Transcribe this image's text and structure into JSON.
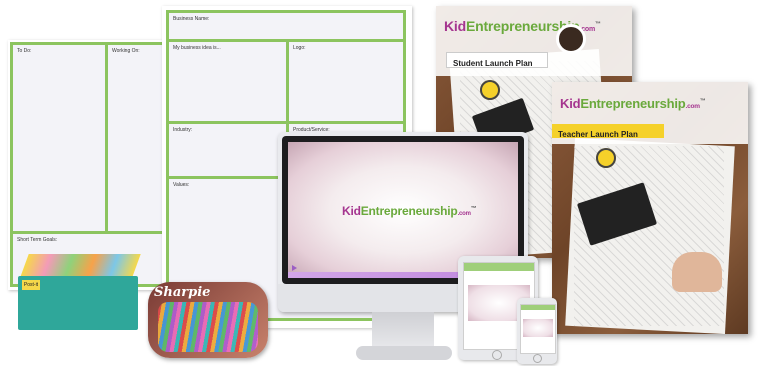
{
  "planning_sheet_left": {
    "to_do": "To Do:",
    "working_on": "Working On:",
    "short_term_goals": "Short Term Goals:"
  },
  "planning_sheet_center": {
    "business_name": "Business Name:",
    "business_idea": "My business idea is...",
    "logo": "Logo:",
    "industry": "Industry:",
    "product_service": "Product/Service:",
    "values": "Values:"
  },
  "brand": {
    "kid": "Kid",
    "entrepreneurship": "Entrepreneurship",
    "dotcom": ".com",
    "tm": "™"
  },
  "books": {
    "student_title": "Student Launch Plan",
    "teacher_title": "Teacher Launch Plan"
  },
  "sticky_notes": {
    "badge": "Post-it"
  },
  "markers": {
    "brand": "Sharpie"
  },
  "colors": {
    "accent_green": "#8cc45f",
    "brand_purple": "#a5358f",
    "brand_green": "#6aa93c",
    "teacher_banner": "#f5d12a"
  }
}
